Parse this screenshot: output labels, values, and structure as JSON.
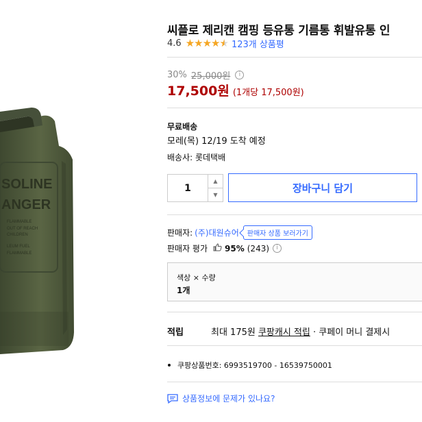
{
  "product": {
    "title": "씨플로 제리캔 캠핑 등유통 기름통 휘발유통 인",
    "rating": "4.6",
    "stars": 4.5,
    "review_count": "123개 상품평"
  },
  "price": {
    "discount_rate": "30%",
    "original": "25,000원",
    "sale": "17,500원",
    "unit": "(1개당 17,500원)"
  },
  "shipping": {
    "title": "무료배송",
    "eta": "모레(목) 12/19 도착 예정",
    "carrier": "배송사: 롯데택배"
  },
  "purchase": {
    "quantity": "1",
    "cart_label": "장바구니 담기"
  },
  "seller": {
    "label": "판매자:",
    "name": "(주)대원슈어",
    "store_link": "판매자 상품 보러가기",
    "rating_label": "판매자 평가",
    "rating_pct": "95%",
    "rating_count": "(243)"
  },
  "option": {
    "label": "색상 × 수량",
    "value": "1개"
  },
  "reward": {
    "label": "적립",
    "prefix": "최대 175원",
    "link": "쿠팡캐시 적립",
    "suffix": "· 쿠페이 머니 결제시"
  },
  "details": {
    "item_number": "쿠팡상품번호: 6993519700 - 16539750001"
  },
  "report": {
    "label": "상품정보에 문제가 있나요?"
  },
  "image_lettering": [
    "SOLINE",
    "ANGER",
    "FLAMMABLE",
    "OUT OF REACH",
    "CHILDREN",
    "LEUM FUEL",
    "FLAMMABLE"
  ],
  "colors": {
    "accent": "#346aff",
    "price": "#ae0000",
    "star": "#f5a623",
    "can_green": "#4f5a3a"
  }
}
